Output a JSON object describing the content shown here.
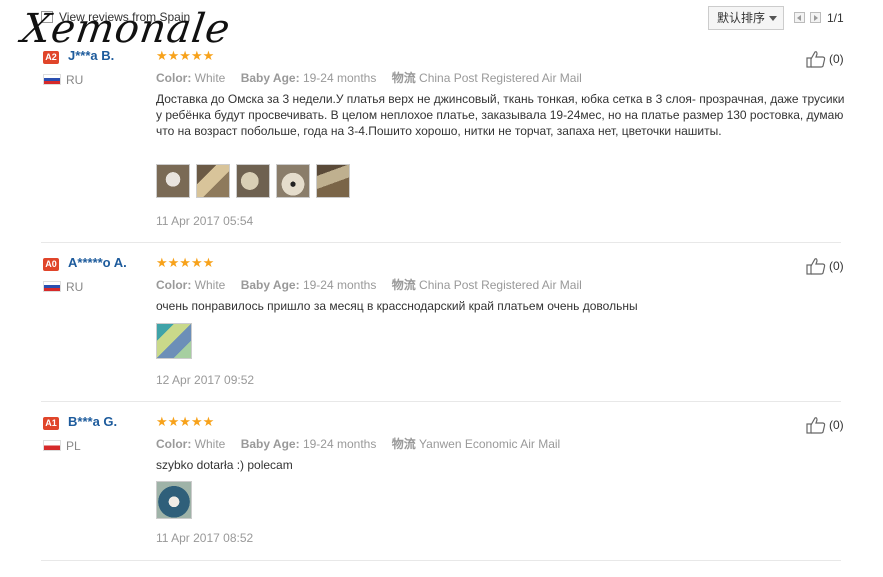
{
  "header": {
    "title": "View reviews from Spain",
    "sort_label": "默认排序",
    "page_text": "1/1",
    "watermark": "Xemonale"
  },
  "reviews": [
    {
      "badge": "A2",
      "name": "J***a B.",
      "country": "RU",
      "rating": 5,
      "stars": "★★★★★",
      "color_label": "Color:",
      "color": "White",
      "age_label": "Baby Age:",
      "age": "19-24 months",
      "ship_label": "物流",
      "shipping": "China Post Registered Air Mail",
      "text": "Доставка до Омска за 3 недели.У платья верх не джинсовый, ткань тонкая, юбка сетка в 3 слоя- прозрачная, даже трусики у ребёнка будут просвечивать. В целом неплохое платье, заказывала 19-24мес, но на платье размер 130 ростовка, думаю что на возраст побольше, года на 3-4.Пошито хорошо, нитки не торчат, запаха нет, цветочки нашиты.",
      "photos": 5,
      "date": "11 Apr 2017 05:54",
      "likes": "(0)"
    },
    {
      "badge": "A0",
      "name": "A*****o A.",
      "country": "RU",
      "rating": 5,
      "stars": "★★★★★",
      "color_label": "Color:",
      "color": "White",
      "age_label": "Baby Age:",
      "age": "19-24 months",
      "ship_label": "物流",
      "shipping": "China Post Registered Air Mail",
      "text": "очень понравилось пришло за месяц в красснодарский край платьем очень довольны",
      "photos": 1,
      "date": "12 Apr 2017 09:52",
      "likes": "(0)"
    },
    {
      "badge": "A1",
      "name": "B***a G.",
      "country": "PL",
      "rating": 5,
      "stars": "★★★★★",
      "color_label": "Color:",
      "color": "White",
      "age_label": "Baby Age:",
      "age": "19-24 months",
      "ship_label": "物流",
      "shipping": "Yanwen Economic Air Mail",
      "text": "szybko dotarła :) polecam",
      "photos": 1,
      "date": "11 Apr 2017 08:52",
      "likes": "(0)"
    }
  ],
  "colors": {
    "name_blue": "#1d5b9c",
    "star_orange": "#f7a21b",
    "badge_red": "#e0452a",
    "meta_gray": "#999999"
  }
}
